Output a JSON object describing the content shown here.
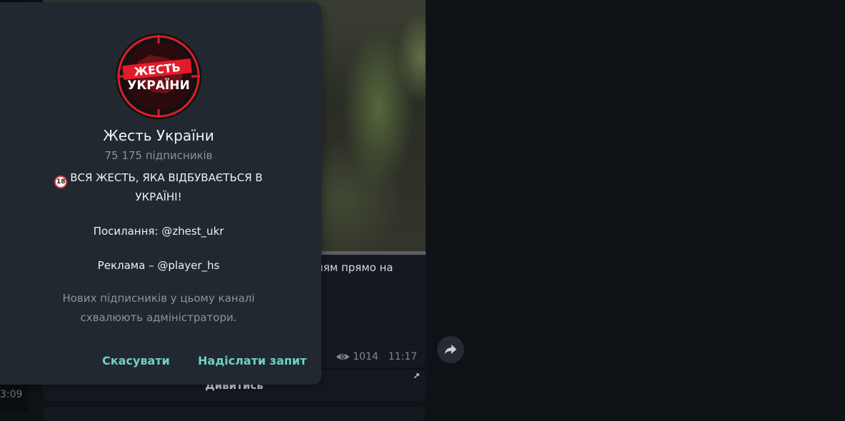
{
  "dialog": {
    "title": "Жесть України",
    "subscribers": "75 175 підписників",
    "avatar_text_line1": "ЖЕСТЬ",
    "avatar_text_line2": "УКРАЇНИ",
    "badge": "18",
    "description_line1": "ВСЯ ЖЕСТЬ, ЯКА ВІДБУВАЄТЬСЯ В УКРАЇНІ!",
    "description_link": "Посилання: @zhest_ukr",
    "description_ads": "Реклама – @player_hs",
    "approval_note": "Нових підписників у цьому каналі схвалюють адміністратори.",
    "cancel_label": "Скасувати",
    "request_label": "Надіслати запит"
  },
  "message": {
    "text_fragment": "нням прямо на",
    "views": "1014",
    "time": "11:17",
    "view_button_label": "Дивитись"
  },
  "left_time": "3:09",
  "colors": {
    "accent": "#6ed0c7",
    "dialog_bg": "#222830",
    "page_bg": "#0e1116",
    "avatar_red": "#e21b2a"
  },
  "icons": [
    "eye-icon",
    "external-arrow-icon",
    "forward-icon",
    "age-18-icon"
  ]
}
